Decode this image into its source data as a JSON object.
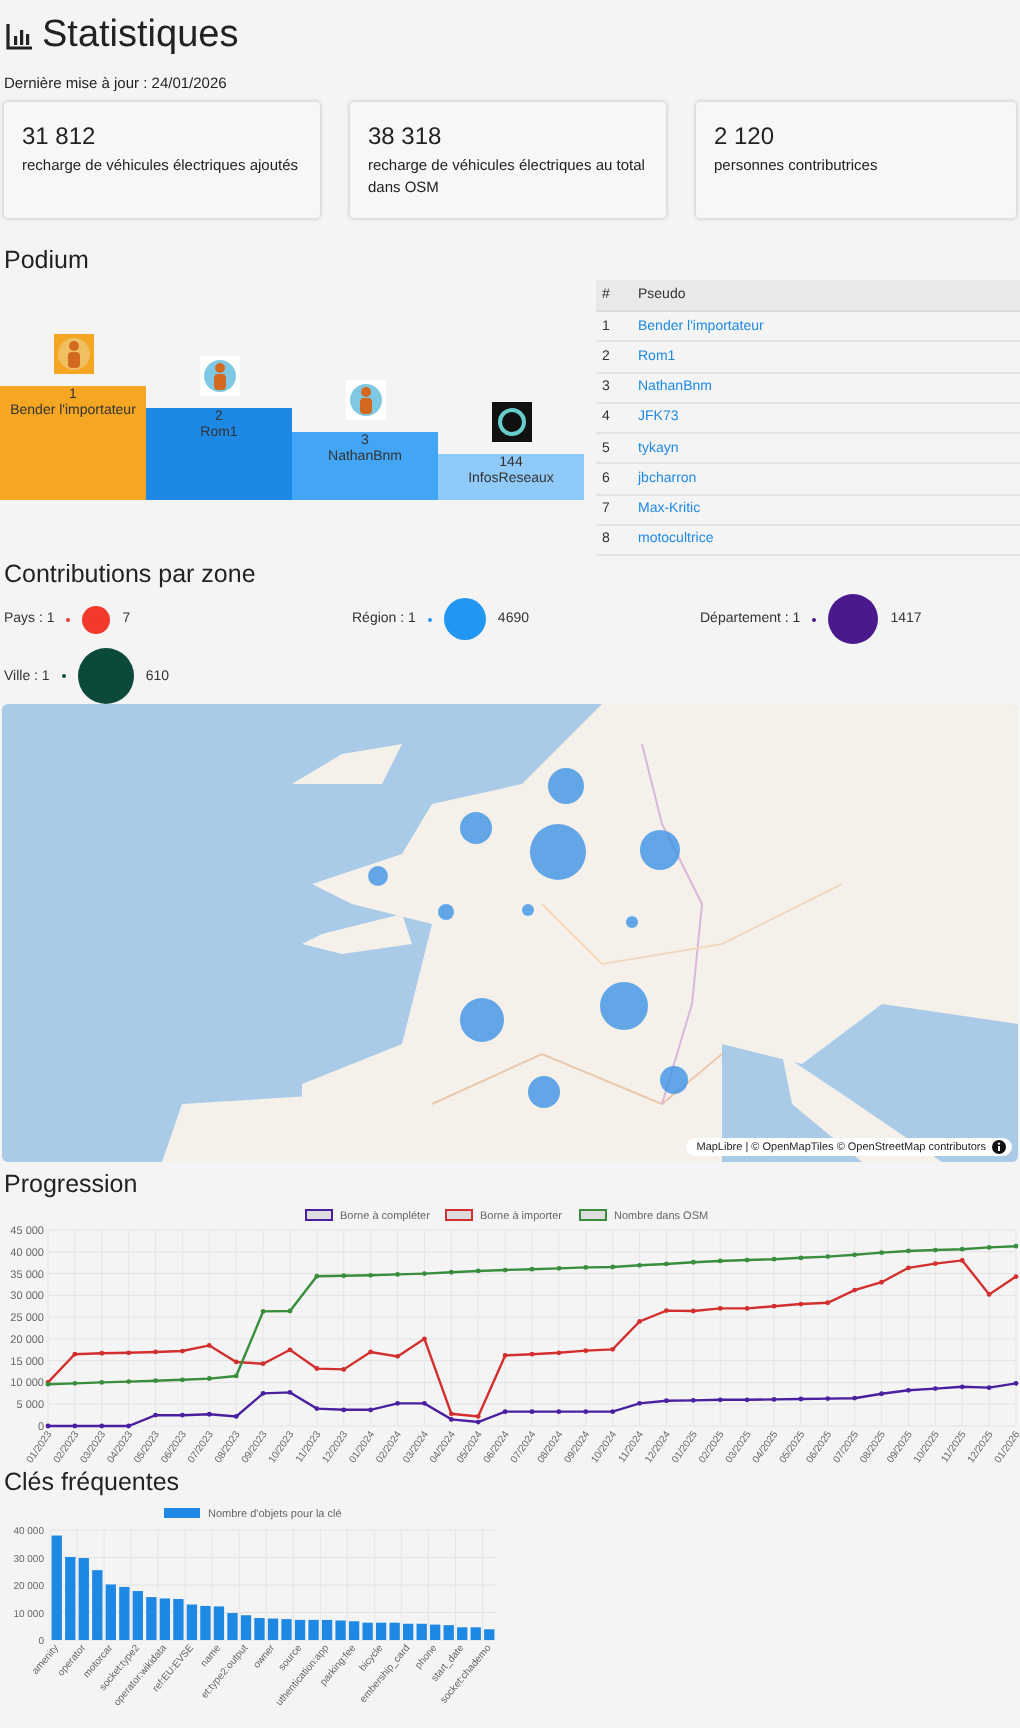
{
  "header": {
    "title": "Statistiques",
    "updated": "Dernière mise à jour : 24/01/2026"
  },
  "summary_cards": [
    {
      "value": "31 812",
      "label": "recharge de véhicules électriques ajoutés"
    },
    {
      "value": "38 318",
      "label": "recharge de véhicules électriques au total dans OSM"
    },
    {
      "value": "2 120",
      "label": "personnes contributrices"
    }
  ],
  "podium": {
    "title": "Podium",
    "places": [
      {
        "rank": "1",
        "name": "Bender l'importateur",
        "color": "#f5a623"
      },
      {
        "rank": "2",
        "name": "Rom1",
        "color": "#1e88e5"
      },
      {
        "rank": "3",
        "name": "NathanBnm",
        "color": "#42a5f5"
      },
      {
        "rank": "144",
        "name": "InfosReseaux",
        "color": "#90caf9"
      }
    ],
    "table": {
      "columns": [
        "#",
        "Pseudo"
      ],
      "rows": [
        {
          "rank": "1",
          "pseudo": "Bender l'importateur"
        },
        {
          "rank": "2",
          "pseudo": "Rom1"
        },
        {
          "rank": "3",
          "pseudo": "NathanBnm"
        },
        {
          "rank": "4",
          "pseudo": "JFK73"
        },
        {
          "rank": "5",
          "pseudo": "tykayn"
        },
        {
          "rank": "6",
          "pseudo": "jbcharron"
        },
        {
          "rank": "7",
          "pseudo": "Max-Kritic"
        },
        {
          "rank": "8",
          "pseudo": "motocultrice"
        }
      ]
    }
  },
  "zones": {
    "title": "Contributions par zone",
    "legend": [
      {
        "label": "Pays : 1",
        "color": "#f23a2b",
        "value": "7"
      },
      {
        "label": "Région : 1",
        "color": "#2196f3",
        "value": "4690"
      },
      {
        "label": "Département : 1",
        "color": "#4a1a8c",
        "value": "1417"
      },
      {
        "label": "Ville : 1",
        "color": "#0b4a3a",
        "value": "610"
      }
    ]
  },
  "map": {
    "kind": "picture",
    "attribution": "MapLibre | © OpenMapTiles © OpenStreetMap contributors"
  },
  "progression": {
    "title": "Progression",
    "chart_data": {
      "type": "line",
      "grid": true,
      "legend": "top",
      "x": [
        "01/2023",
        "02/2023",
        "03/2023",
        "04/2023",
        "05/2023",
        "06/2023",
        "07/2023",
        "08/2023",
        "09/2023",
        "10/2023",
        "11/2023",
        "12/2023",
        "01/2024",
        "02/2024",
        "03/2024",
        "04/2024",
        "05/2024",
        "06/2024",
        "07/2024",
        "08/2024",
        "09/2024",
        "10/2024",
        "11/2024",
        "12/2024",
        "01/2025",
        "02/2025",
        "03/2025",
        "04/2025",
        "05/2025",
        "06/2025",
        "07/2025",
        "08/2025",
        "09/2025",
        "10/2025",
        "11/2025",
        "12/2025",
        "01/2026"
      ],
      "series": [
        {
          "name": "Borne à compléter",
          "color": "#4a1fa0",
          "values": [
            0,
            0,
            0,
            0,
            2500,
            2500,
            2700,
            2200,
            7500,
            7700,
            4000,
            3700,
            3700,
            5200,
            5200,
            1500,
            900,
            3300,
            3300,
            3300,
            3300,
            3300,
            5200,
            5800,
            5900,
            6000,
            6000,
            6100,
            6200,
            6300,
            6400,
            7400,
            8200,
            8600,
            9000,
            8800,
            9800
          ]
        },
        {
          "name": "Borne à importer",
          "color": "#d32f2f",
          "values": [
            10000,
            16500,
            16700,
            16800,
            17000,
            17200,
            18500,
            14700,
            14300,
            17500,
            13200,
            13000,
            17000,
            16000,
            20000,
            2800,
            2200,
            16200,
            16500,
            16800,
            17300,
            17600,
            24000,
            26500,
            26400,
            27000,
            27000,
            27500,
            28000,
            28300,
            31200,
            33000,
            36300,
            37300,
            38000,
            30200,
            34300
          ]
        },
        {
          "name": "Nombre dans OSM",
          "color": "#388e3c",
          "values": [
            9600,
            9800,
            10000,
            10200,
            10400,
            10600,
            10900,
            11500,
            26300,
            26400,
            34400,
            34500,
            34600,
            34800,
            35000,
            35300,
            35600,
            35800,
            36000,
            36200,
            36400,
            36500,
            36900,
            37200,
            37600,
            37900,
            38100,
            38300,
            38600,
            38900,
            39300,
            39800,
            40200,
            40400,
            40600,
            41000,
            41300
          ]
        }
      ],
      "ylim": [
        0,
        45000
      ],
      "yticks": [
        {
          "value": 0,
          "label": "0"
        },
        {
          "value": 5000,
          "label": "5 000"
        },
        {
          "value": 10000,
          "label": "10 000"
        },
        {
          "value": 15000,
          "label": "15 000"
        },
        {
          "value": 20000,
          "label": "20 000"
        },
        {
          "value": 25000,
          "label": "25 000"
        },
        {
          "value": 30000,
          "label": "30 000"
        },
        {
          "value": 35000,
          "label": "35 000"
        },
        {
          "value": 40000,
          "label": "40 000"
        },
        {
          "value": 45000,
          "label": "45 000"
        }
      ]
    }
  },
  "frequent_keys": {
    "title": "Clés fréquentes",
    "chart_data": {
      "type": "bar",
      "grid": true,
      "legend": "top",
      "categories": [
        "amenity",
        null,
        "operator",
        null,
        "motorcar",
        null,
        "socket:type2",
        null,
        "operator:wikidata",
        null,
        "ref:EU:EVSE",
        null,
        "name",
        null,
        "et:type2:output",
        null,
        "owner",
        null,
        "source",
        null,
        "uthentication:app",
        null,
        "parking:fee",
        null,
        "bicycle",
        null,
        "embership_card",
        null,
        "phone",
        null,
        "start_date",
        null,
        "socket:chademo"
      ],
      "series": [
        {
          "name": "Nombre d'objets pour la clé",
          "color": "#1e88e5",
          "values": [
            38000,
            30200,
            29800,
            25400,
            20200,
            19300,
            17800,
            15600,
            15100,
            14900,
            12900,
            12400,
            12200,
            9800,
            9000,
            8000,
            7800,
            7600,
            7300,
            7300,
            7300,
            7100,
            6800,
            6300,
            6300,
            6300,
            5900,
            5900,
            5600,
            5400,
            4600,
            4600,
            3900
          ]
        }
      ],
      "ylim": [
        0,
        40000
      ],
      "yticks": [
        {
          "value": 0,
          "label": "0"
        },
        {
          "value": 10000,
          "label": "10 000"
        },
        {
          "value": 20000,
          "label": "20 000"
        },
        {
          "value": 30000,
          "label": "30 000"
        },
        {
          "value": 40000,
          "label": "40 000"
        }
      ]
    }
  }
}
